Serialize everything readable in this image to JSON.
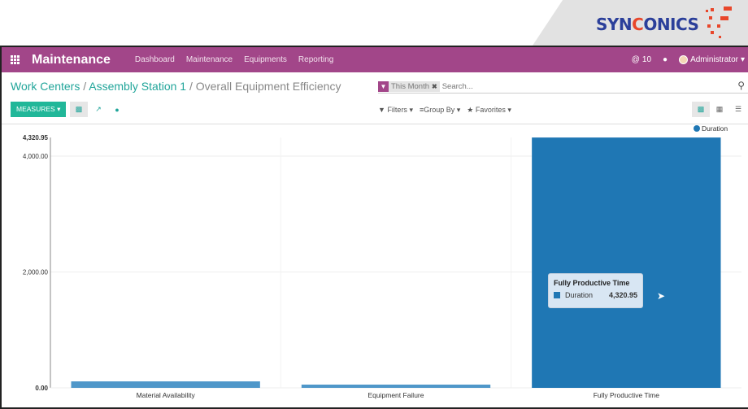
{
  "logo": {
    "text_pre": "SYN",
    "text_accent": "C",
    "text_post": "ONICS"
  },
  "navbar": {
    "app_title": "Maintenance",
    "menu": [
      "Dashboard",
      "Maintenance",
      "Equipments",
      "Reporting"
    ],
    "notifications": "10",
    "user": "Administrator"
  },
  "breadcrumb": {
    "items": [
      "Work Centers",
      "Assembly Station 1"
    ],
    "current": "Overall Equipment Efficiency",
    "separator": "/"
  },
  "search": {
    "facet": "This Month",
    "placeholder": "Search..."
  },
  "toolbar": {
    "measures_label": "MEASURES ▾",
    "filters": "Filters ▾",
    "group_by": "Group By ▾",
    "favorites": "Favorites ▾"
  },
  "chart_data": {
    "type": "bar",
    "categories": [
      "Material Availability",
      "Equipment Failure",
      "Fully Productive Time"
    ],
    "series": [
      {
        "name": "Duration",
        "color": "#1f77b4",
        "values": [
          112,
          56,
          4320.95
        ]
      }
    ],
    "yticks": [
      "0.00",
      "2,000.00",
      "4,000.00",
      "4,320.95"
    ],
    "ylim": [
      0,
      4320.95
    ],
    "legend": "top-right",
    "grid": true,
    "tooltip": {
      "title": "Fully Productive Time",
      "series": "Duration",
      "value": "4,320.95"
    }
  }
}
